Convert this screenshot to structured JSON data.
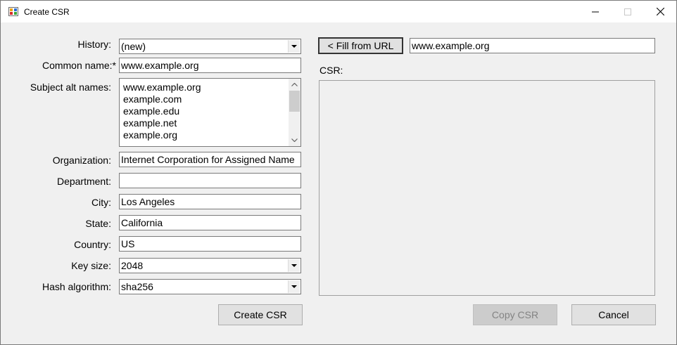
{
  "window": {
    "title": "Create CSR",
    "icon": "app-certificate-icon",
    "controls": [
      "minimize-icon",
      "maximize-icon",
      "close-icon"
    ]
  },
  "form": {
    "history": {
      "label": "History:",
      "value": "(new)"
    },
    "common_name": {
      "label": "Common name:*",
      "value": "www.example.org"
    },
    "subject_alt_names": {
      "label": "Subject alt names:",
      "items": [
        "www.example.org",
        "example.com",
        "example.edu",
        "example.net",
        "example.org"
      ]
    },
    "organization": {
      "label": "Organization:",
      "value": "Internet Corporation for Assigned Name"
    },
    "department": {
      "label": "Department:",
      "value": ""
    },
    "city": {
      "label": "City:",
      "value": "Los Angeles"
    },
    "state": {
      "label": "State:",
      "value": "California"
    },
    "country": {
      "label": "Country:",
      "value": "US"
    },
    "key_size": {
      "label": "Key size:",
      "value": "2048"
    },
    "hash_algorithm": {
      "label": "Hash algorithm:",
      "value": "sha256"
    }
  },
  "url_fill": {
    "button_label": "< Fill from URL",
    "url_value": "www.example.org"
  },
  "csr": {
    "label": "CSR:",
    "content": ""
  },
  "buttons": {
    "create": "Create CSR",
    "copy": "Copy CSR",
    "cancel": "Cancel"
  }
}
